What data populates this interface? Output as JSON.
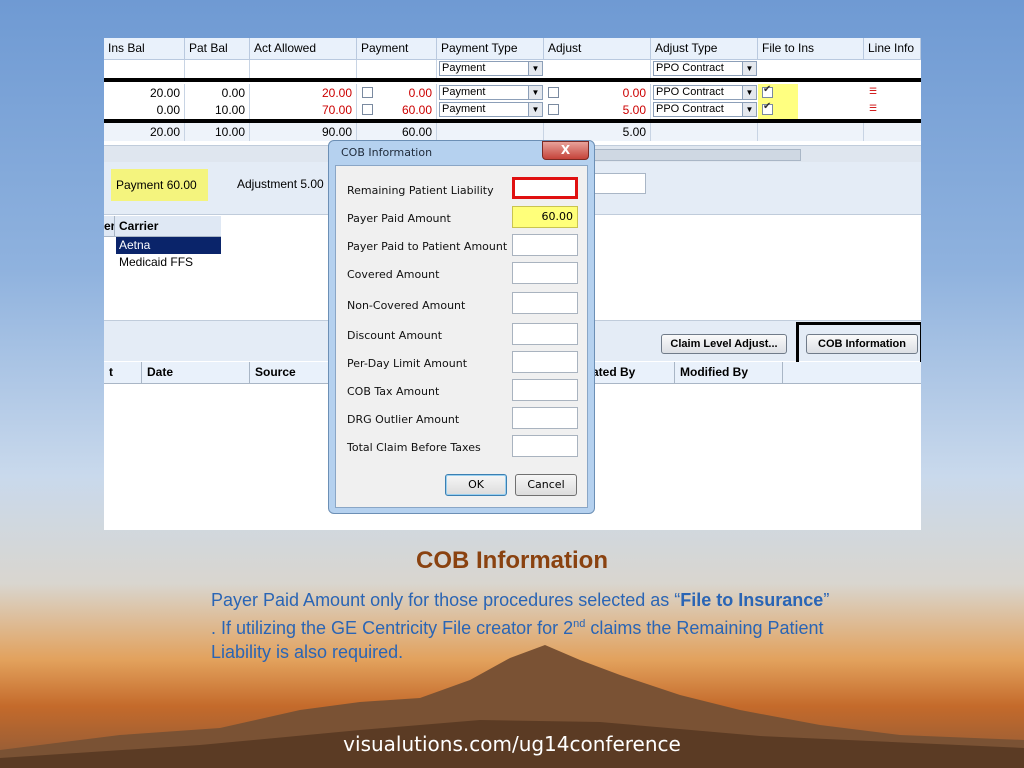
{
  "grid": {
    "columns": [
      "Ins Bal",
      "Pat Bal",
      "Act Allowed",
      "Payment",
      "Payment Type",
      "Adjust",
      "Adjust Type",
      "File to Ins",
      "Line Info"
    ],
    "new_row": {
      "payment_type": "Payment",
      "adjust_type": "PPO Contract"
    },
    "rows": [
      {
        "ins_bal": "20.00",
        "pat_bal": "0.00",
        "act_allowed": "20.00",
        "payment": "0.00",
        "payment_type": "Payment",
        "adjust": "0.00",
        "adjust_type": "PPO Contract",
        "file_to_ins": true
      },
      {
        "ins_bal": "0.00",
        "pat_bal": "10.00",
        "act_allowed": "70.00",
        "payment": "60.00",
        "payment_type": "Payment",
        "adjust": "5.00",
        "adjust_type": "PPO Contract",
        "file_to_ins": true
      }
    ],
    "totals": {
      "ins_bal": "20.00",
      "pat_bal": "10.00",
      "act_allowed": "90.00",
      "payment": "60.00",
      "adjust": "5.00"
    }
  },
  "summary": {
    "payment": "Payment  60.00",
    "adjustment": "Adjustment  5.00"
  },
  "carriers": {
    "header_cut": "er",
    "header": "Carrier",
    "items": [
      "Aetna",
      "Medicaid FFS"
    ]
  },
  "buttons": {
    "claim_level_adjust": "Claim Level Adjust...",
    "cob_information": "COB Information"
  },
  "lower_grid": {
    "columns": [
      "t",
      "Date",
      "Source",
      "ated By",
      "Modified By"
    ]
  },
  "dialog": {
    "title": "COB Information",
    "close_glyph": "X",
    "fields": [
      {
        "label": "Remaining Patient Liability",
        "value": ""
      },
      {
        "label": "Payer Paid Amount",
        "value": "60.00"
      },
      {
        "label": "Payer Paid to Patient Amount",
        "value": ""
      },
      {
        "label": "Covered Amount",
        "value": ""
      },
      {
        "label": "Non-Covered Amount",
        "value": ""
      },
      {
        "label": "Discount Amount",
        "value": ""
      },
      {
        "label": "Per-Day Limit Amount",
        "value": ""
      },
      {
        "label": "COB Tax Amount",
        "value": ""
      },
      {
        "label": "DRG Outlier Amount",
        "value": ""
      },
      {
        "label": "Total Claim Before Taxes",
        "value": ""
      }
    ],
    "ok": "OK",
    "cancel": "Cancel"
  },
  "slide": {
    "title": "COB Information",
    "body_1": "Payer Paid Amount only for those procedures selected as “",
    "body_bold": "File to Insurance",
    "body_2": "” .  If utilizing the GE Centricity File creator for 2",
    "body_sup": "nd",
    "body_3": " claims the Remaining Patient Liability is also required.",
    "footer": "visualutions.com/ug14conference"
  },
  "colors": {
    "title": "#8a4210",
    "body": "#2a65b5",
    "required_border": "#e01010",
    "highlight": "#ffff7a"
  }
}
